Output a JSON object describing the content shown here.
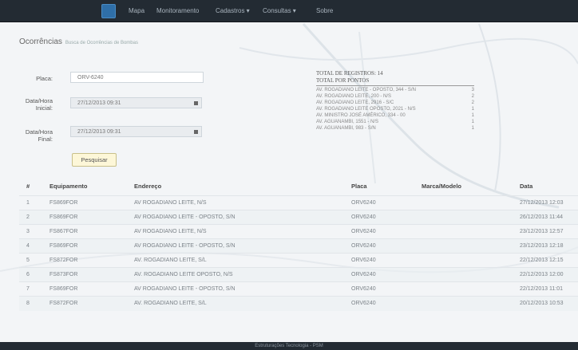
{
  "nav": {
    "items": [
      "Mapa",
      "Monitoramento",
      "Cadastros ▾",
      "Consultas ▾",
      "Sobre"
    ]
  },
  "page": {
    "title": "Ocorrências",
    "subtitle": "Busca de Ocorrências de Bombas"
  },
  "form": {
    "placa_label": "Placa:",
    "placa_value": "ORV-6240",
    "inicial_label": "Data/Hora Inicial:",
    "inicial_value": "27/12/2013 09:31",
    "final_label": "Data/Hora Final:",
    "final_value": "27/12/2013 09:31",
    "submit_label": "Pesquisar"
  },
  "summary": {
    "total_registros": "TOTAL DE REGISTROS: 14",
    "total_pontos": "TOTAL POR PONTOS",
    "points": [
      {
        "name": "AV. ROGADIANO LEITE - OPOSTO, 344 - S/N",
        "count": "3"
      },
      {
        "name": "AV. ROGADIANO LEITE, 200 - N/S",
        "count": "2"
      },
      {
        "name": "AV. ROGADIANO LEITE, 2916 - S/C",
        "count": "2"
      },
      {
        "name": "AV. ROGADIANO LEITE OPOSTO, 2021 - N/S",
        "count": "1"
      },
      {
        "name": "AV. MINISTRO JOSÉ AMÉRICO, 334 - 00",
        "count": "1"
      },
      {
        "name": "AV. AGUANAMBI, 1551 - N/S",
        "count": "1"
      },
      {
        "name": "AV. AGUANAMBI, 983 - S/N",
        "count": "1"
      }
    ]
  },
  "table": {
    "headers": [
      "#",
      "Equipamento",
      "Endereço",
      "Placa",
      "Marca/Modelo",
      "Data"
    ],
    "rows": [
      [
        "1",
        "FS869FOR",
        "AV ROGADIANO LEITE, N/S",
        "ORV6240",
        "",
        "27/12/2013 12:03"
      ],
      [
        "2",
        "FS869FOR",
        "AV ROGADIANO LEITE - OPOSTO, S/N",
        "ORV6240",
        "",
        "26/12/2013 11:44"
      ],
      [
        "3",
        "FS867FOR",
        "AV ROGADIANO LEITE, N/S",
        "ORV6240",
        "",
        "23/12/2013 12:57"
      ],
      [
        "4",
        "FS869FOR",
        "AV ROGADIANO LEITE - OPOSTO, S/N",
        "ORV6240",
        "",
        "23/12/2013 12:18"
      ],
      [
        "5",
        "FS872FOR",
        "AV. ROGADIANO LEITE, S/L",
        "ORV6240",
        "",
        "22/12/2013 12:15"
      ],
      [
        "6",
        "FS873FOR",
        "AV. ROGADIANO LEITE OPOSTO, N/S",
        "ORV6240",
        "",
        "22/12/2013 12:00"
      ],
      [
        "7",
        "FS869FOR",
        "AV ROGADIANO LEITE - OPOSTO, S/N",
        "ORV6240",
        "",
        "22/12/2013 11:01"
      ],
      [
        "8",
        "FS872FOR",
        "AV. ROGADIANO LEITE, S/L",
        "ORV6240",
        "",
        "20/12/2013 10:53"
      ]
    ]
  },
  "footer": {
    "text": "Estruturações Tecnologia - PSM"
  }
}
